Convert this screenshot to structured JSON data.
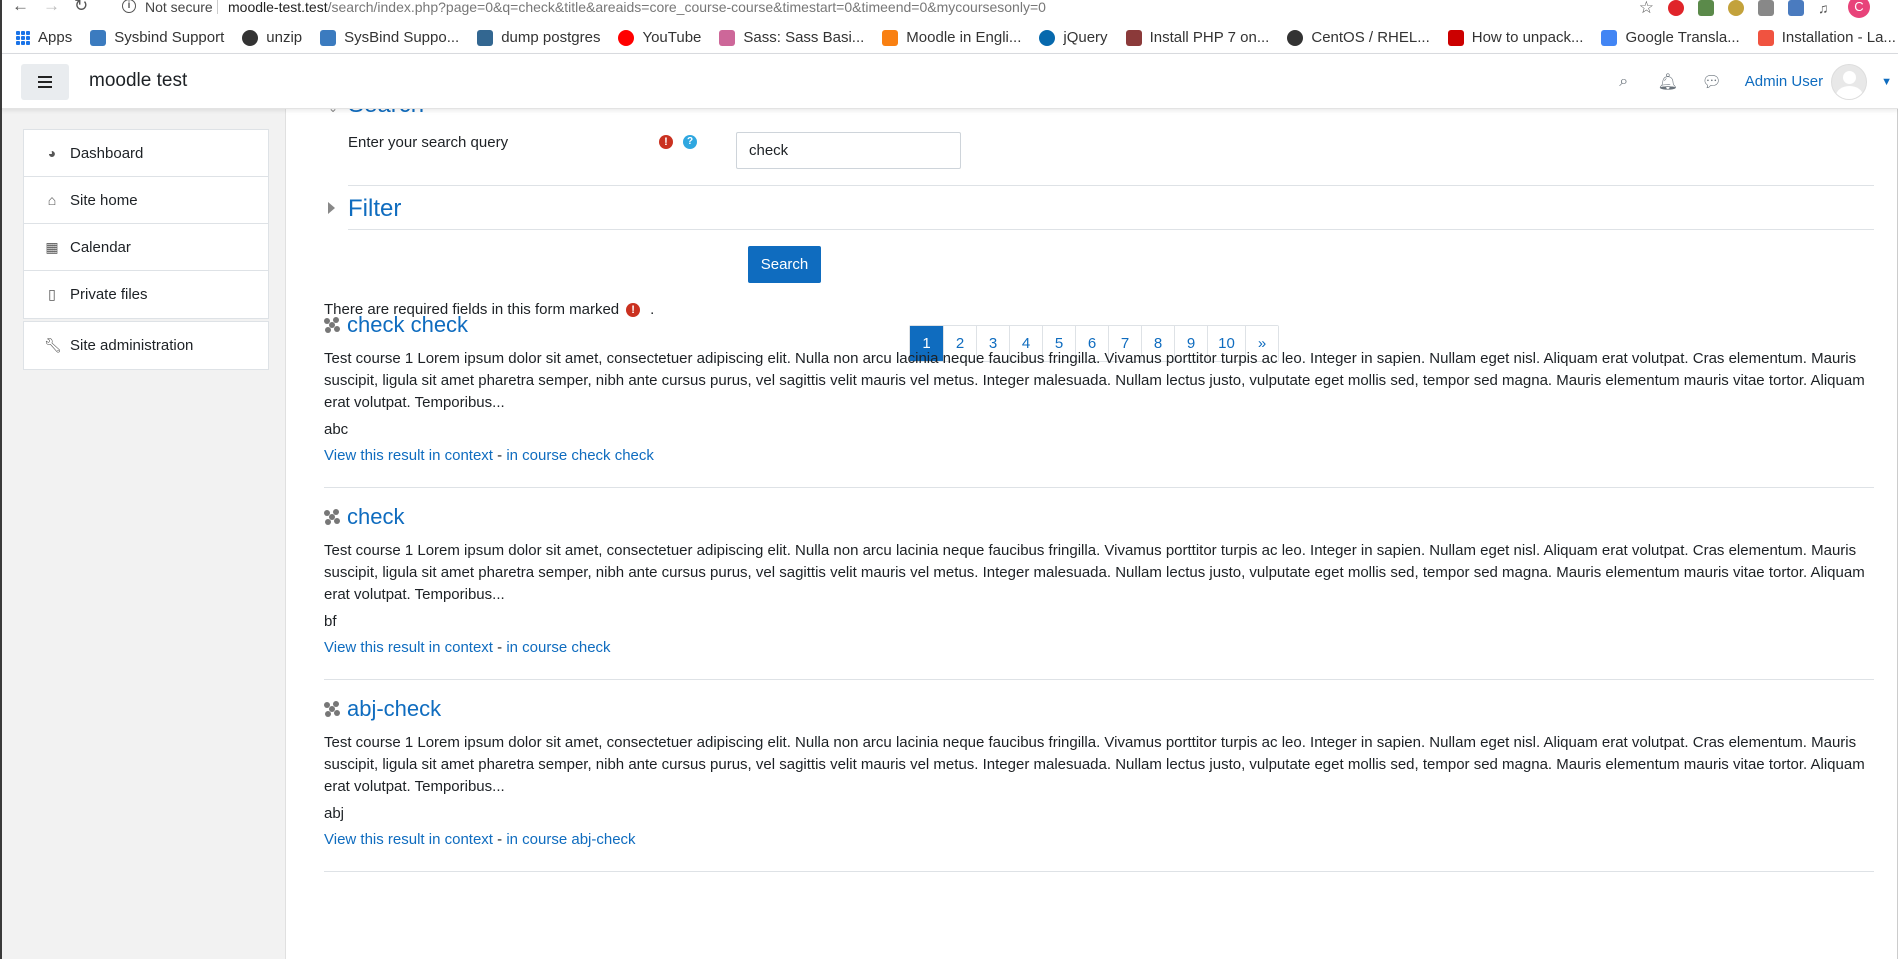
{
  "browser": {
    "security_label": "Not secure",
    "url_host": "moodle-test.test",
    "url_path": "/search/index.php?page=0&q=check&title&areaids=core_course-course&timestart=0&timeend=0&mycoursesonly=0",
    "profile_initial": "C",
    "bookmarks": [
      {
        "label": "Apps",
        "icon": "apps-grid-icon",
        "color": "#1a73e8"
      },
      {
        "label": "Sysbind Support",
        "icon": "sysbind-icon",
        "color": "#3b7bbf"
      },
      {
        "label": "unzip",
        "icon": "centos-icon",
        "color": "#333333"
      },
      {
        "label": "SysBind Suppo...",
        "icon": "sysbind-icon",
        "color": "#3b7bbf"
      },
      {
        "label": "dump postgres",
        "icon": "postgres-icon",
        "color": "#336791"
      },
      {
        "label": "YouTube",
        "icon": "youtube-icon",
        "color": "#ff0000"
      },
      {
        "label": "Sass: Sass Basi...",
        "icon": "sass-icon",
        "color": "#cd6799"
      },
      {
        "label": "Moodle in Engli...",
        "icon": "moodle-icon",
        "color": "#f98012"
      },
      {
        "label": "jQuery",
        "icon": "jquery-icon",
        "color": "#0769ad"
      },
      {
        "label": "Install PHP 7 on...",
        "icon": "tecmint-icon",
        "color": "#8b3a3a"
      },
      {
        "label": "CentOS / RHEL...",
        "icon": "centos-icon",
        "color": "#333333"
      },
      {
        "label": "How to unpack...",
        "icon": "r-icon",
        "color": "#cc0000"
      },
      {
        "label": "Google Transla...",
        "icon": "translate-icon",
        "color": "#4285f4"
      },
      {
        "label": "Installation - La...",
        "icon": "laravel-icon",
        "color": "#f05340"
      }
    ]
  },
  "navbar": {
    "site_name": "moodle test",
    "user_name": "Admin User"
  },
  "drawer": {
    "items": [
      {
        "label": "Dashboard",
        "icon": "dashboard-icon",
        "glyph": "◕"
      },
      {
        "label": "Site home",
        "icon": "home-icon",
        "glyph": "⌂"
      },
      {
        "label": "Calendar",
        "icon": "calendar-icon",
        "glyph": "▦"
      },
      {
        "label": "Private files",
        "icon": "file-icon",
        "glyph": "▯"
      }
    ],
    "admin_item": {
      "label": "Site administration",
      "icon": "wrench-icon",
      "glyph": "🔧"
    }
  },
  "search_form": {
    "section_title": "Search",
    "query_label": "Enter your search query",
    "query_value": "check",
    "filter_title": "Filter",
    "submit_label": "Search",
    "required_note": "There are required fields in this form marked",
    "required_note_end": "."
  },
  "pagination": {
    "pages": [
      "1",
      "2",
      "3",
      "4",
      "5",
      "6",
      "7",
      "8",
      "9",
      "10"
    ],
    "active": "1",
    "next_label": "»"
  },
  "results": [
    {
      "title": "check check",
      "summary": "Test course 1 Lorem ipsum dolor sit amet, consectetuer adipiscing elit. Nulla non arcu lacinia neque faucibus fringilla. Vivamus porttitor turpis ac leo. Integer in sapien. Nullam eget nisl. Aliquam erat volutpat. Cras elementum. Mauris suscipit, ligula sit amet pharetra semper, nibh ante cursus purus, vel sagittis velit mauris vel metus. Integer malesuada. Nullam lectus justo, vulputate eget mollis sed, tempor sed magna. Mauris elementum mauris vitae tortor. Aliquam erat volutpat. Temporibus...",
      "extra": "abc",
      "context_link": "View this result in context",
      "separator": " - ",
      "course_link": "in course check check"
    },
    {
      "title": "check",
      "summary": "Test course 1 Lorem ipsum dolor sit amet, consectetuer adipiscing elit. Nulla non arcu lacinia neque faucibus fringilla. Vivamus porttitor turpis ac leo. Integer in sapien. Nullam eget nisl. Aliquam erat volutpat. Cras elementum. Mauris suscipit, ligula sit amet pharetra semper, nibh ante cursus purus, vel sagittis velit mauris vel metus. Integer malesuada. Nullam lectus justo, vulputate eget mollis sed, tempor sed magna. Mauris elementum mauris vitae tortor. Aliquam erat volutpat. Temporibus...",
      "extra": "bf",
      "context_link": "View this result in context",
      "separator": " - ",
      "course_link": "in course check"
    },
    {
      "title": "abj-check",
      "summary": "Test course 1 Lorem ipsum dolor sit amet, consectetuer adipiscing elit. Nulla non arcu lacinia neque faucibus fringilla. Vivamus porttitor turpis ac leo. Integer in sapien. Nullam eget nisl. Aliquam erat volutpat. Cras elementum. Mauris suscipit, ligula sit amet pharetra semper, nibh ante cursus purus, vel sagittis velit mauris vel metus. Integer malesuada. Nullam lectus justo, vulputate eget mollis sed, tempor sed magna. Mauris elementum mauris vitae tortor. Aliquam erat volutpat. Temporibus...",
      "extra": "abj",
      "context_link": "View this result in context",
      "separator": " - ",
      "course_link": "in course abj-check"
    }
  ],
  "colors": {
    "brand": "#0f6cbf",
    "required": "#ca3120",
    "help": "#2fa7e0"
  }
}
